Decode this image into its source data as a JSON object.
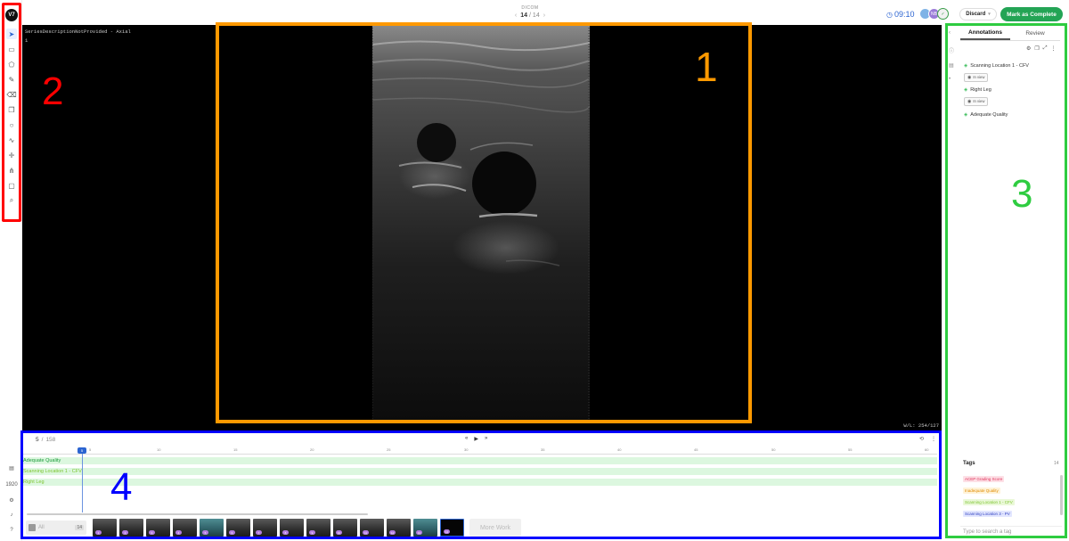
{
  "header": {
    "dicom_label": "DICOM",
    "frame_current": "14",
    "frame_sep": "/",
    "frame_total": "14",
    "timer": "09:10",
    "avatar_initials": "NB",
    "discard_label": "Discard",
    "complete_label": "Mark as Complete"
  },
  "toolbar": {
    "logo": "V7",
    "tools": [
      "cursor-icon",
      "bounding-box-icon",
      "polygon-icon",
      "brush-icon",
      "eraser-icon",
      "copy-icon",
      "ellipse-icon",
      "line-icon",
      "keypoint-icon",
      "skeleton-icon",
      "comment-icon",
      "zoom-icon"
    ],
    "bottom_label": "1920"
  },
  "viewer": {
    "series_label": "SeriesDescriptionNotProvided - Axial",
    "series_index": "1",
    "window_level": "W/L: 254/127"
  },
  "callouts": {
    "one": "1",
    "two": "2",
    "three": "3",
    "four": "4"
  },
  "panel": {
    "tab_annotations": "Annotations",
    "tab_review": "Review",
    "annotations": [
      {
        "label": "Scanning Location 1 - CFV",
        "status": "In view"
      },
      {
        "label": "Right Leg",
        "status": "In view"
      },
      {
        "label": "Adequate Quality",
        "status": ""
      }
    ],
    "tags_title": "Tags",
    "tags_count": "14",
    "tags": [
      {
        "label": "ACEP Grading Score",
        "bg": "#fde0e6",
        "fg": "#e0315a"
      },
      {
        "label": "Inadequate Quality",
        "bg": "#fff3d8",
        "fg": "#e08a00"
      },
      {
        "label": "Scanning Location 1 - CFV",
        "bg": "#eaf8d8",
        "fg": "#7cc42f"
      },
      {
        "label": "Scanning Location 3 - PV",
        "bg": "#e2e6ff",
        "fg": "#2b3cbf"
      }
    ],
    "search_placeholder": "Type to search a tag"
  },
  "timeline": {
    "frame_current": "5",
    "frame_sep": "/",
    "frame_total": "158",
    "playhead_frame": "5",
    "ticks": [
      "5",
      "10",
      "15",
      "20",
      "25",
      "30",
      "35",
      "40",
      "45",
      "50",
      "55",
      "60"
    ],
    "tracks": [
      {
        "label": "Adequate Quality",
        "color": "#1a9b3a"
      },
      {
        "label": "Scanning Location 1 - CFV",
        "color": "#7cc42f"
      },
      {
        "label": "Right Leg",
        "color": "#7cc42f"
      }
    ],
    "series_all_label": "All",
    "series_all_count": "14",
    "thumb_badges": [
      "1",
      "2",
      "3",
      "4",
      "5",
      "6",
      "7",
      "8",
      "9",
      "10",
      "11",
      "12",
      "13",
      "14"
    ],
    "more_work_label": "More Work"
  }
}
